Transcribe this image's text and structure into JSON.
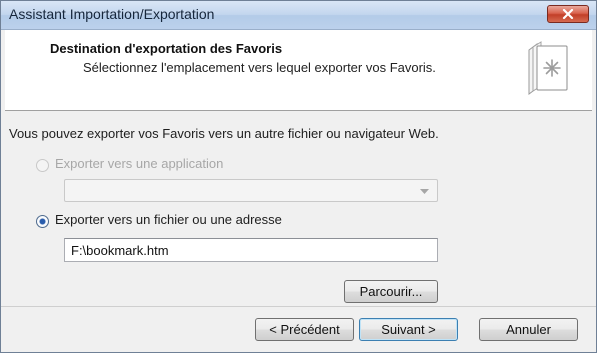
{
  "window": {
    "title": "Assistant Importation/Exportation"
  },
  "header": {
    "title": "Destination d'exportation des Favoris",
    "subtitle": "Sélectionnez l'emplacement vers lequel exporter vos Favoris.",
    "icon": "bookmark-export-icon"
  },
  "content": {
    "intro": "Vous pouvez exporter vos Favoris vers un autre fichier ou navigateur Web.",
    "option_app": {
      "label": "Exporter vers une application",
      "selected": false,
      "enabled": false,
      "value": ""
    },
    "option_file": {
      "label": "Exporter vers un fichier ou une adresse",
      "selected": true,
      "enabled": true,
      "value": "F:\\bookmark.htm"
    },
    "browse_label": "Parcourir..."
  },
  "footer": {
    "back_label": "< Précédent",
    "next_label": "Suivant >",
    "cancel_label": "Annuler"
  },
  "colors": {
    "titlebar": "#c3d6ee",
    "close_button": "#c94a33",
    "selection": "#2a5dad"
  }
}
